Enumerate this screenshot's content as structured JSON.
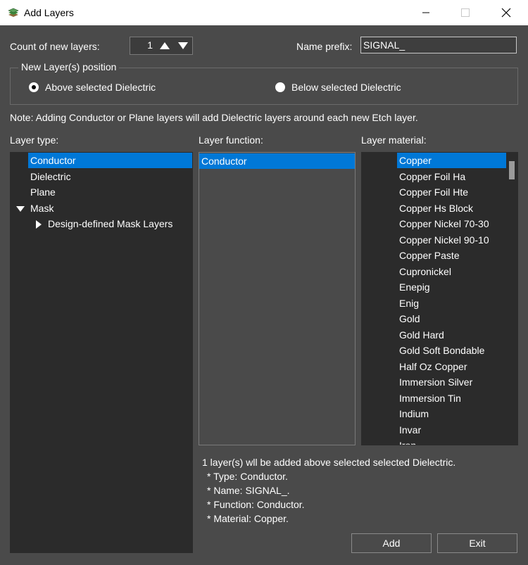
{
  "window": {
    "title": "Add Layers",
    "app_icon": "layers-stack-icon",
    "minimize_icon": "minimize-icon",
    "maximize_icon": "maximize-icon",
    "close_icon": "close-icon"
  },
  "count": {
    "label": "Count of new layers:",
    "value": "1"
  },
  "name_prefix": {
    "label": "Name prefix:",
    "value": "SIGNAL_"
  },
  "position_group": {
    "title": "New Layer(s) position",
    "above_label": "Above selected Dielectric",
    "below_label": "Below selected Dielectric",
    "selected": "above"
  },
  "note": "Note: Adding Conductor or Plane layers will add Dielectric layers around each new Etch layer.",
  "layer_type": {
    "label": "Layer type:",
    "items": [
      "Conductor",
      "Dielectric",
      "Plane",
      "Mask",
      "Design-defined Mask Layers"
    ],
    "selected": "Conductor"
  },
  "layer_function": {
    "label": "Layer function:",
    "items": [
      "Conductor"
    ],
    "selected": "Conductor"
  },
  "layer_material": {
    "label": "Layer material:",
    "items": [
      "Copper",
      "Copper Foil Ha",
      "Copper Foil Hte",
      "Copper Hs Block",
      "Copper Nickel 70-30",
      "Copper Nickel 90-10",
      "Copper Paste",
      "Cupronickel",
      "Enepig",
      "Enig",
      "Gold",
      "Gold Hard",
      "Gold Soft Bondable",
      "Half Oz Copper",
      "Immersion Silver",
      "Immersion Tin",
      "Indium",
      "Invar",
      "Iron"
    ],
    "selected": "Copper"
  },
  "summary": [
    "1 layer(s) wll be added above selected selected Dielectric.",
    "* Type: Conductor.",
    "* Name: SIGNAL_.",
    "* Function: Conductor.",
    "* Material: Copper."
  ],
  "buttons": {
    "add": "Add",
    "exit": "Exit"
  },
  "colors": {
    "dialog_bg": "#4a4a4a",
    "list_bg": "#2b2b2b",
    "selection": "#0078d7"
  }
}
